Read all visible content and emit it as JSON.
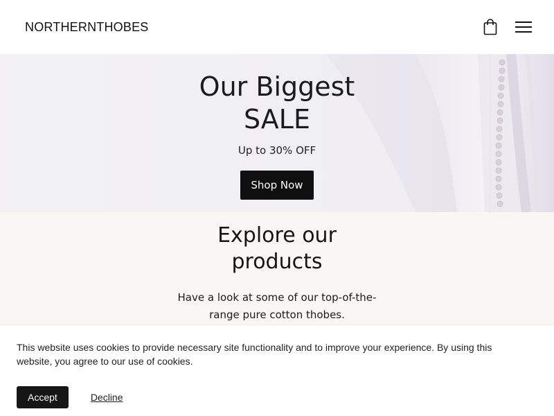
{
  "header": {
    "brand": "NORTHERNTHOBES",
    "cart_icon": "shopping-bag-icon",
    "menu_icon": "hamburger-menu-icon"
  },
  "hero": {
    "title": "Our Biggest SALE",
    "subtitle": "Up to 30% OFF",
    "cta_label": "Shop Now",
    "background_image": "white-thobe-closeup-with-buttons"
  },
  "explore": {
    "title": "Explore our products",
    "description": "Have a look at some of our top-of-the-range pure cotton thobes."
  },
  "cookie_banner": {
    "message": "This website uses cookies to provide necessary site functionality and to improve your experience. By using this website, you agree to our use of cookies.",
    "accept_label": "Accept",
    "decline_label": "Decline"
  },
  "colors": {
    "primary_button": "#0f0f0f",
    "explore_background": "#f8f7f4",
    "hero_background": "#eeedf2"
  }
}
